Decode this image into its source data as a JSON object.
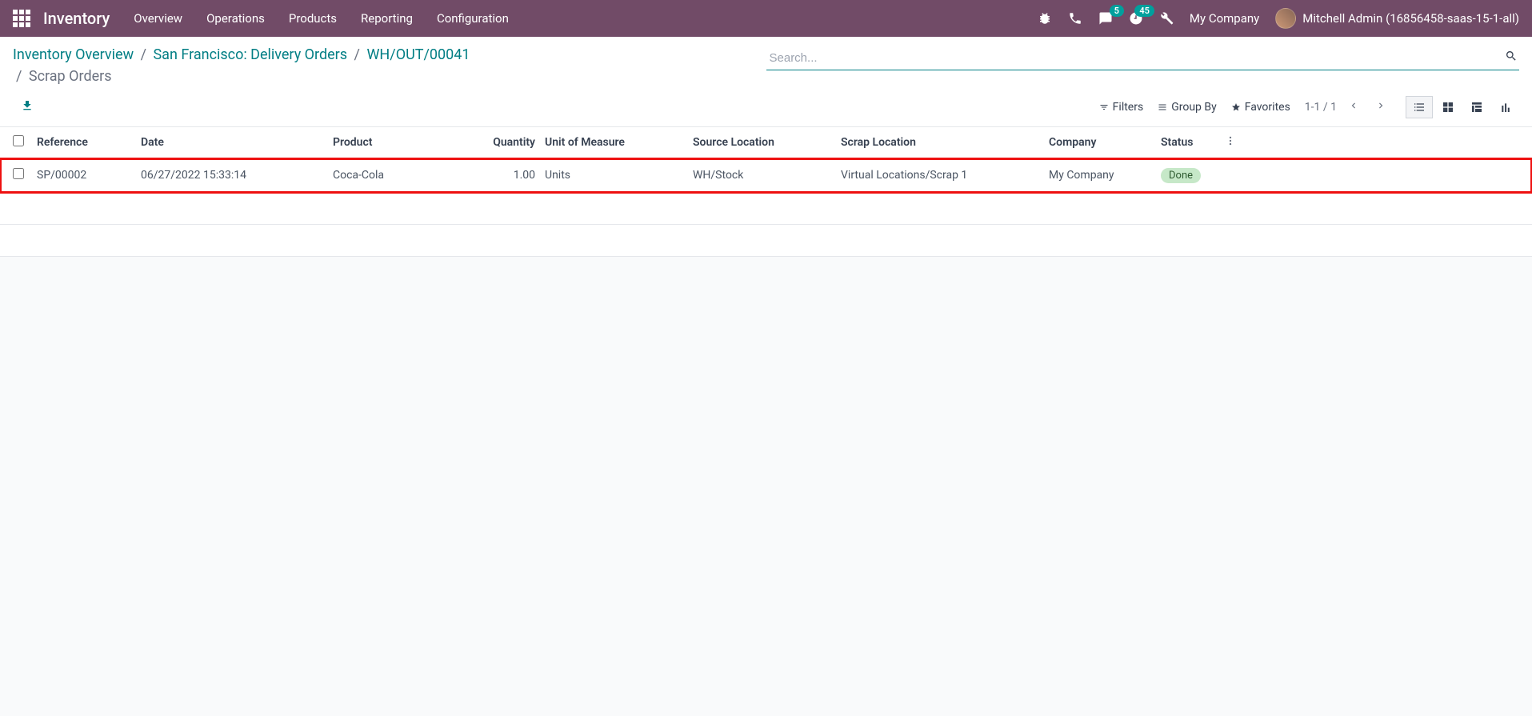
{
  "navbar": {
    "brand": "Inventory",
    "links": [
      "Overview",
      "Operations",
      "Products",
      "Reporting",
      "Configuration"
    ],
    "messages_badge": "5",
    "activities_badge": "45",
    "company": "My Company",
    "user": "Mitchell Admin (16856458-saas-15-1-all)"
  },
  "breadcrumb": {
    "items": [
      "Inventory Overview",
      "San Francisco: Delivery Orders",
      "WH/OUT/00041"
    ],
    "current": "Scrap Orders"
  },
  "search": {
    "placeholder": "Search..."
  },
  "toolbar": {
    "filters": "Filters",
    "groupby": "Group By",
    "favorites": "Favorites",
    "pager": "1-1 / 1"
  },
  "columns": {
    "reference": "Reference",
    "date": "Date",
    "product": "Product",
    "quantity": "Quantity",
    "uom": "Unit of Measure",
    "source": "Source Location",
    "scrap": "Scrap Location",
    "company": "Company",
    "status": "Status"
  },
  "rows": [
    {
      "reference": "SP/00002",
      "date": "06/27/2022 15:33:14",
      "product": "Coca-Cola",
      "quantity": "1.00",
      "uom": "Units",
      "source": "WH/Stock",
      "scrap": "Virtual Locations/Scrap 1",
      "company": "My Company",
      "status": "Done"
    }
  ]
}
